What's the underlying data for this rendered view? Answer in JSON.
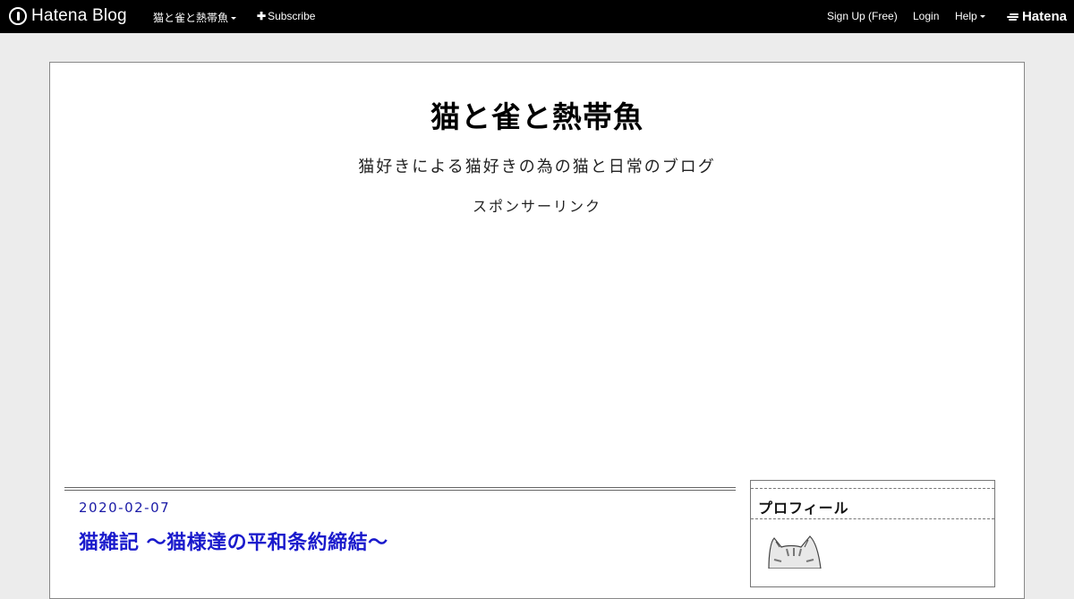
{
  "topbar": {
    "brand": "Hatena Blog",
    "blog_menu": "猫と雀と熱帯魚",
    "subscribe": "Subscribe",
    "signup": "Sign Up (Free)",
    "login": "Login",
    "help": "Help",
    "hatena": "Hatena"
  },
  "header": {
    "title": "猫と雀と熱帯魚",
    "description": "猫好きによる猫好きの為の猫と日常のブログ",
    "sponsor": "スポンサーリンク"
  },
  "entry": {
    "date": "2020-02-07",
    "title": "猫雑記 ～猫様達の平和条約締結～"
  },
  "sidebar": {
    "profile_heading": "プロフィール"
  }
}
